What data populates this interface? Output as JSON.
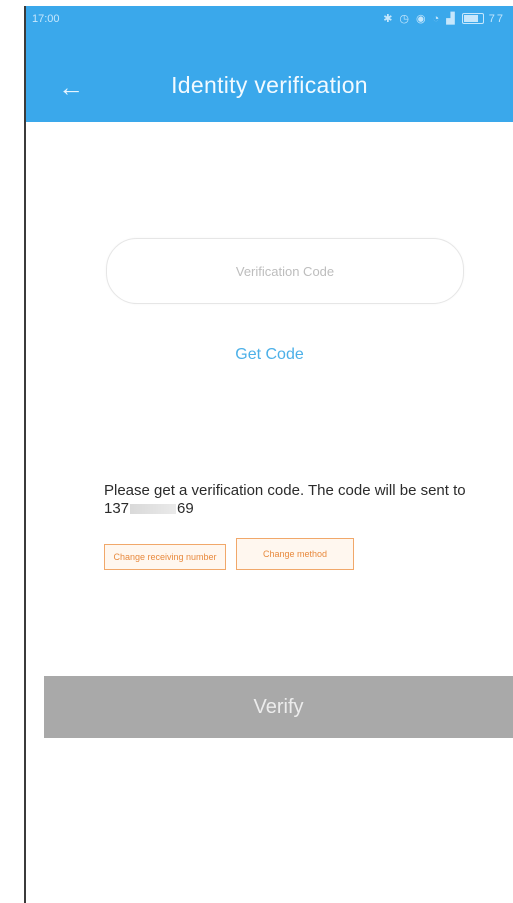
{
  "status_bar": {
    "time": "17:00",
    "icons": [
      "bluetooth-icon",
      "alarm-icon",
      "location-icon",
      "wifi-icon",
      "signal-icon",
      "battery-icon"
    ],
    "battery": "77"
  },
  "header": {
    "title": "Identity verification",
    "back_icon": "back-arrow-icon",
    "color": "#3aa8eb"
  },
  "form": {
    "code_placeholder": "Verification Code",
    "get_code_label": "Get Code",
    "info_text_prefix": "Please get a verification code. The code will be sent to 137",
    "info_text_suffix": "69"
  },
  "options": {
    "change_number_label": "Change receiving number",
    "change_method_label": "Change method"
  },
  "actions": {
    "verify_label": "Verify"
  }
}
